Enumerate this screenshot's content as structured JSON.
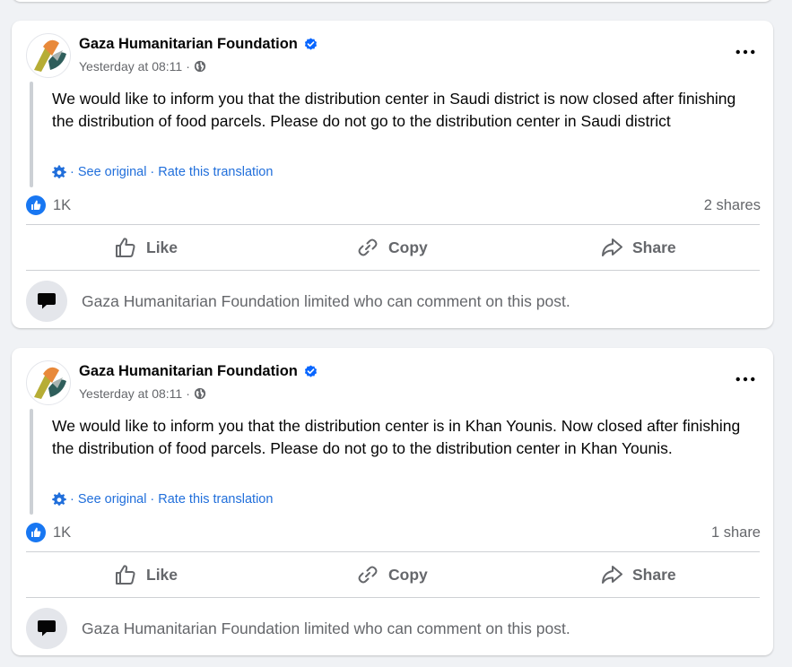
{
  "posts": [
    {
      "author": "Gaza Humanitarian Foundation",
      "timestamp": "Yesterday at 08:11",
      "meta_separator": "·",
      "text": "We would like to inform you that the distribution center in Saudi district is now closed after finishing the distribution of food parcels. Please do not go to the distribution center in Saudi district",
      "translation": {
        "sep": "·",
        "see_original": "See original",
        "rate": "Rate this translation"
      },
      "reaction_count": "1K",
      "shares": "2 shares",
      "actions": {
        "like": "Like",
        "copy": "Copy",
        "share": "Share"
      },
      "comment_notice": "Gaza Humanitarian Foundation limited who can comment on this post."
    },
    {
      "author": "Gaza Humanitarian Foundation",
      "timestamp": "Yesterday at 08:11",
      "meta_separator": "·",
      "text": "We would like to inform you that the distribution center is in Khan Younis. Now closed after finishing the distribution of food parcels. Please do not go to the distribution center in Khan Younis.",
      "translation": {
        "sep": "·",
        "see_original": "See original",
        "rate": "Rate this translation"
      },
      "reaction_count": "1K",
      "shares": "1 share",
      "actions": {
        "like": "Like",
        "copy": "Copy",
        "share": "Share"
      },
      "comment_notice": "Gaza Humanitarian Foundation limited who can comment on this post."
    }
  ],
  "icons": {
    "verified": "verified-badge-icon",
    "audience": "globe-icon",
    "more": "more-options-icon",
    "translate": "gear-icon",
    "reaction": "like-reaction-icon",
    "like": "thumbs-up-icon",
    "copy": "link-icon",
    "share": "share-arrow-icon",
    "comment": "comment-bubble-icon"
  },
  "colors": {
    "background": "#f0f2f5",
    "card": "#ffffff",
    "link": "#216fdb",
    "secondary_text": "#65676b",
    "verified": "#0866ff",
    "avatar_orange": "#e8893a",
    "avatar_olive": "#b6ad35",
    "avatar_teal": "#2f5e5b",
    "avatar_gray": "#a8b3b1"
  }
}
